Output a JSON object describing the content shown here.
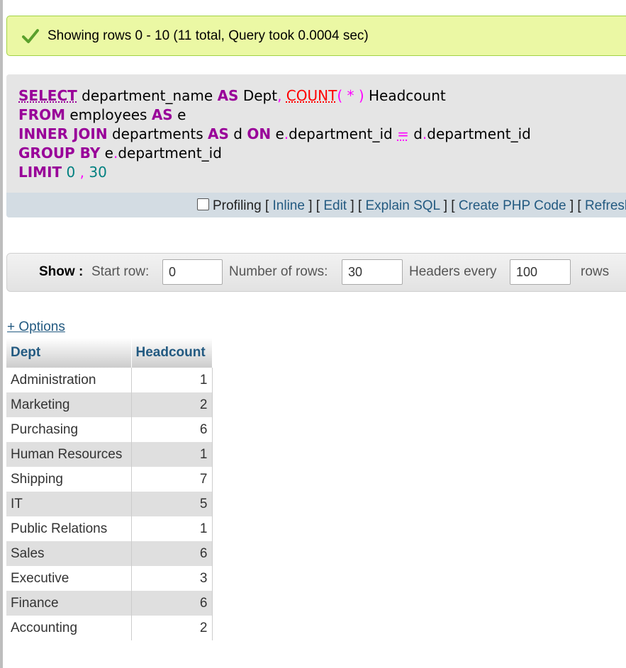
{
  "success": {
    "message": "Showing rows 0 - 10 (11 total, Query took 0.0004 sec)",
    "icon": "check-icon",
    "color": "#ebf8a4"
  },
  "sql": {
    "select_kw": "SELECT",
    "col1": "department_name",
    "as1": "AS",
    "alias1": "Dept",
    "comma1": ",",
    "count_fn": "COUNT",
    "count_args": "( * )",
    "alias2": "Headcount",
    "from_kw": "FROM",
    "table1": "employees",
    "as2": "AS",
    "alias_e": "e",
    "join_kw": "INNER JOIN",
    "table2": "departments",
    "as3": "AS",
    "alias_d": "d",
    "on_kw": "ON",
    "left_tbl": "e",
    "dot": ".",
    "left_col": "department_id",
    "eq": "=",
    "right_tbl": "d",
    "right_col": "department_id",
    "group_kw": "GROUP BY",
    "group_tbl": "e",
    "group_col": "department_id",
    "limit_kw": "LIMIT",
    "limit_start": "0",
    "limit_comma": ",",
    "limit_count": "30"
  },
  "sql_toolbar": {
    "profiling": "Profiling",
    "inline": "Inline",
    "edit": "Edit",
    "explain": "Explain SQL",
    "create_php": "Create PHP Code",
    "refresh": "Refresh"
  },
  "show_bar": {
    "show_label": "Show :",
    "start_row_label": "Start row:",
    "start_row_value": "0",
    "num_rows_label": "Number of rows:",
    "num_rows_value": "30",
    "headers_label": "Headers every",
    "headers_value": "100",
    "rows_label": "rows"
  },
  "options_link": "+ Options",
  "table": {
    "columns": [
      "Dept",
      "Headcount"
    ],
    "rows": [
      [
        "Administration",
        "1"
      ],
      [
        "Marketing",
        "2"
      ],
      [
        "Purchasing",
        "6"
      ],
      [
        "Human Resources",
        "1"
      ],
      [
        "Shipping",
        "7"
      ],
      [
        "IT",
        "5"
      ],
      [
        "Public Relations",
        "1"
      ],
      [
        "Sales",
        "6"
      ],
      [
        "Executive",
        "3"
      ],
      [
        "Finance",
        "6"
      ],
      [
        "Accounting",
        "2"
      ]
    ]
  }
}
